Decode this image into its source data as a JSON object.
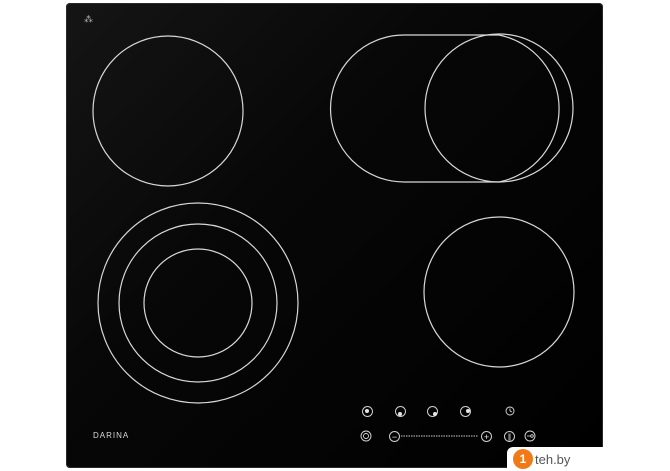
{
  "brand": {
    "name": "DARINA"
  },
  "watermark": {
    "badge": "1",
    "text": "teh.by"
  },
  "icons": {
    "top_left": "child-lock-icon",
    "zone_selectors": [
      "zone-rear-left-icon",
      "zone-front-left-icon",
      "zone-front-right-icon",
      "zone-rear-right-icon"
    ],
    "timer": "timer-icon",
    "power": "power-icon",
    "minus": "minus-icon",
    "plus": "plus-icon",
    "pause": "pause-icon",
    "lock": "key-lock-icon"
  },
  "glyphs": {
    "top_left": "⁂",
    "minus": "−",
    "plus": "+",
    "pause": "‖"
  },
  "colors": {
    "glass": "#000000",
    "rings": "#d8d8d8",
    "watermark_accent": "#f07a18"
  }
}
